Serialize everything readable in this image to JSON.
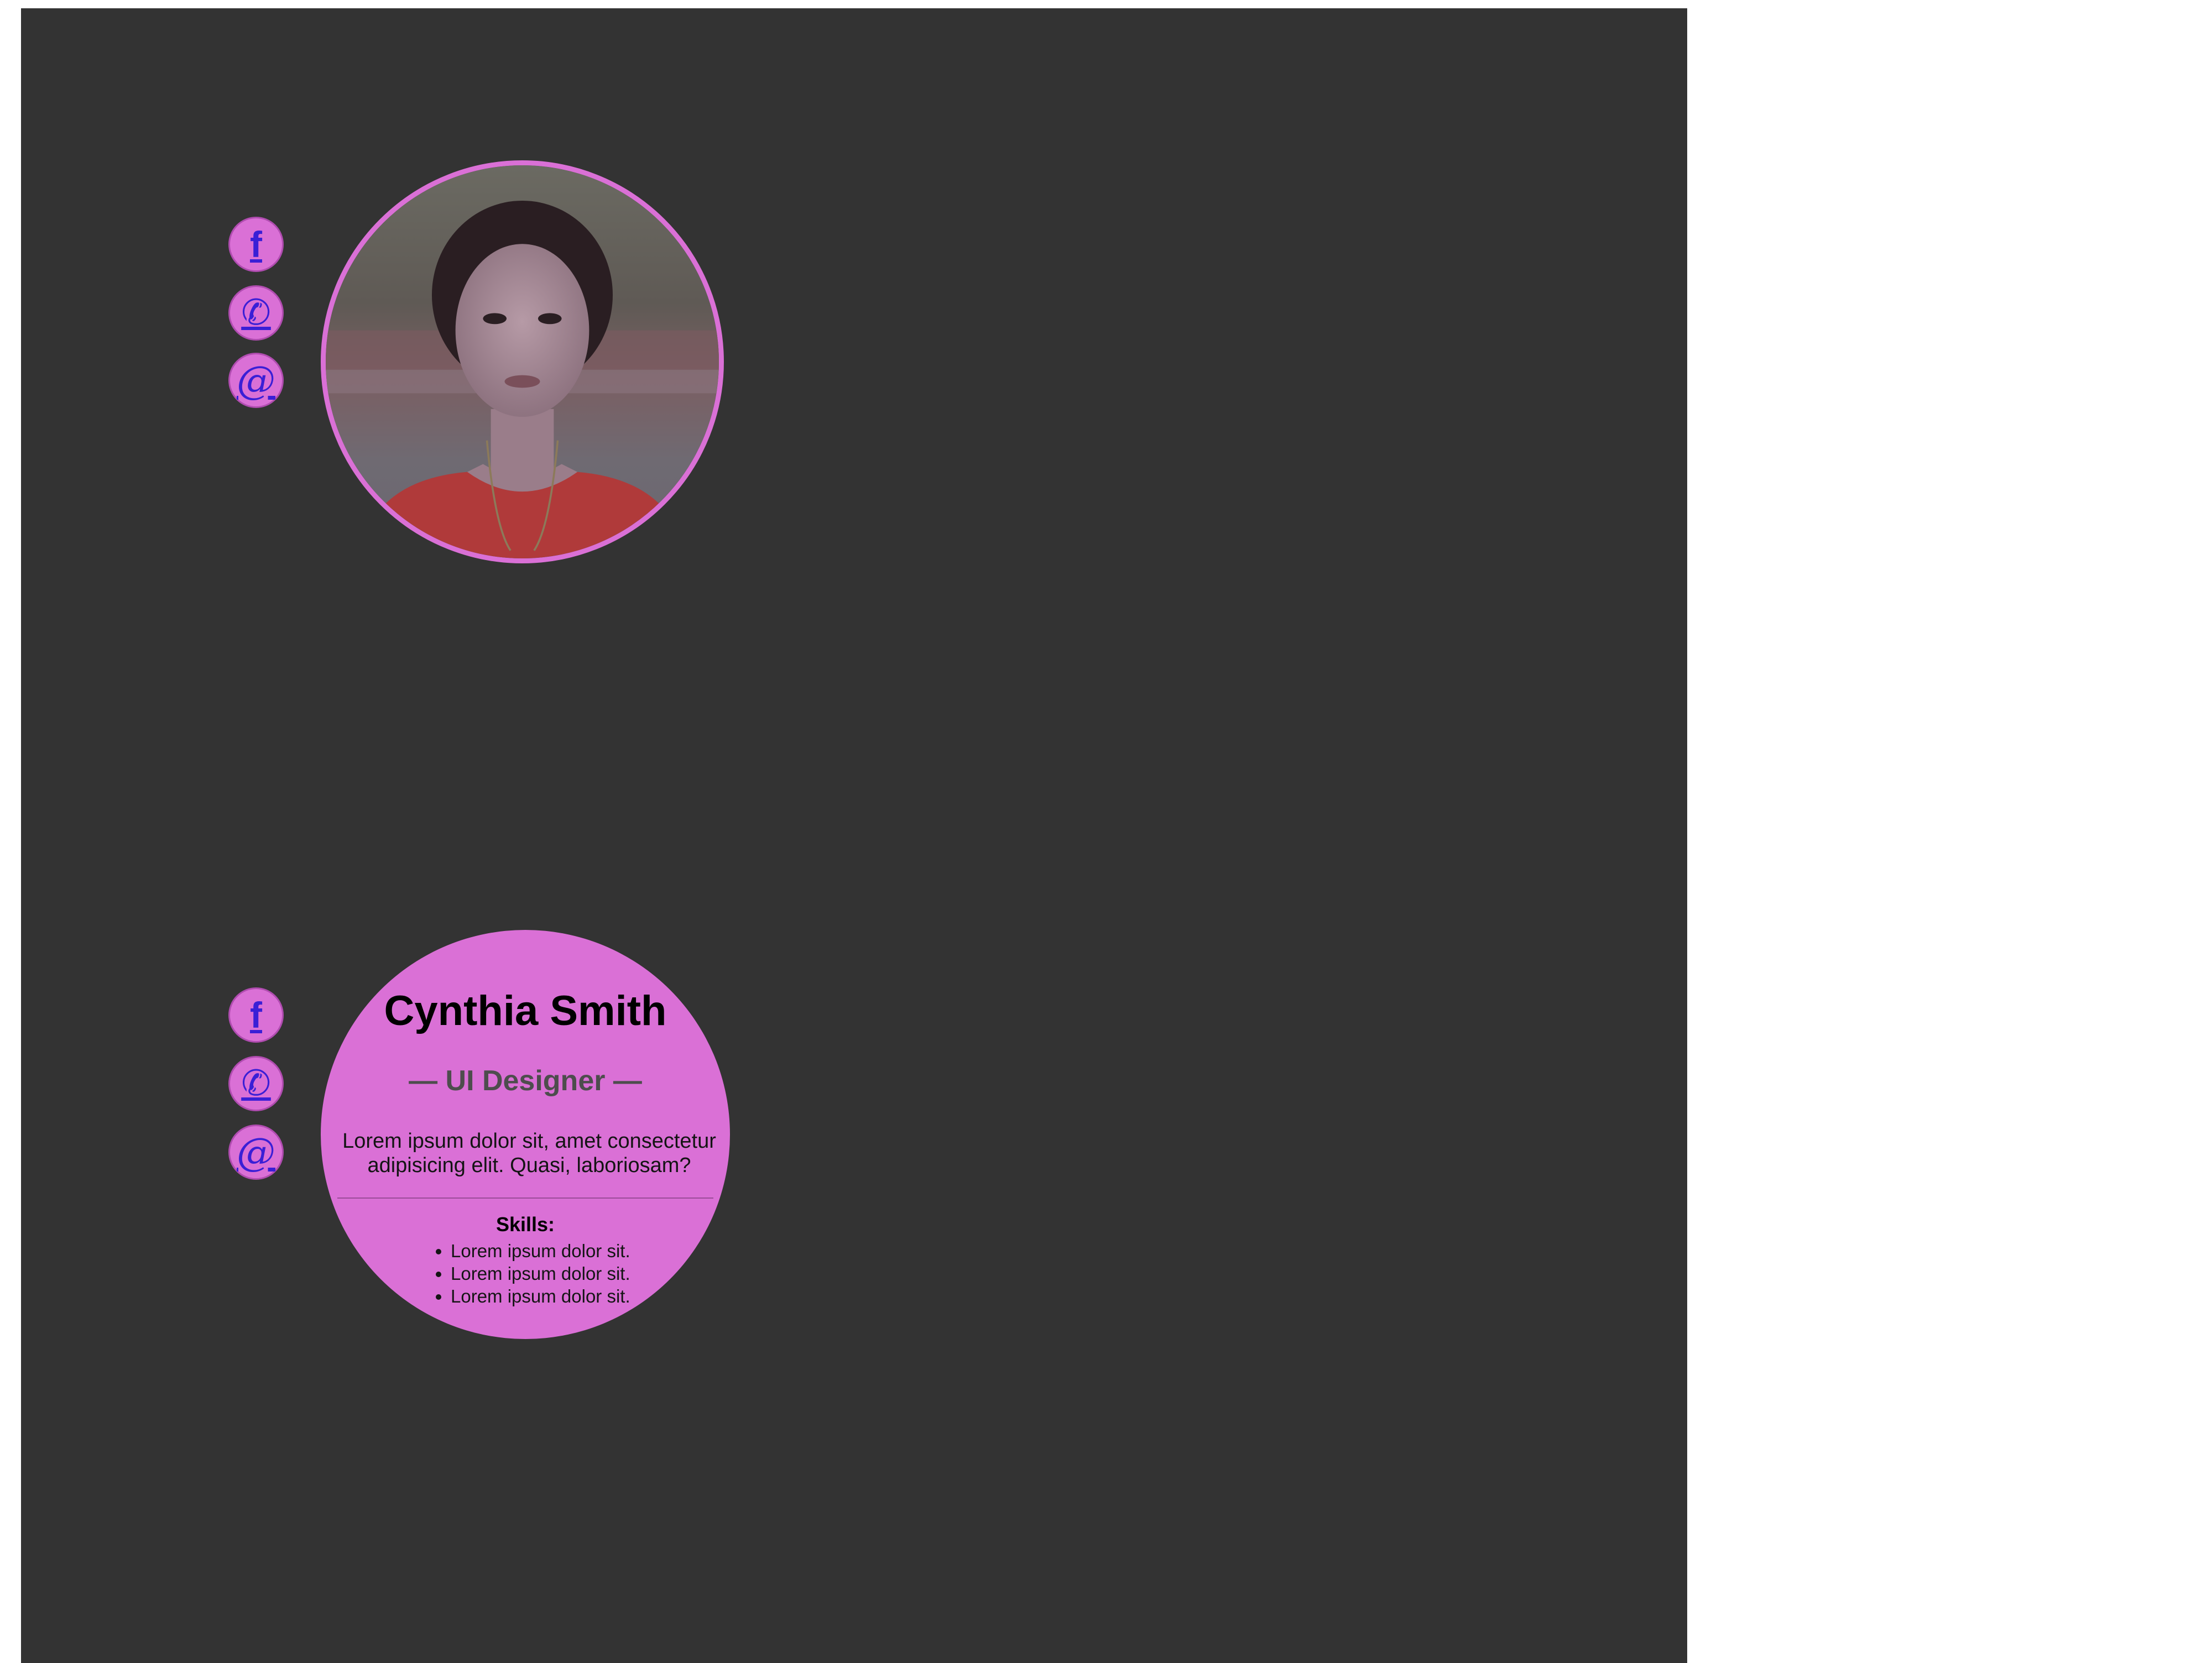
{
  "social": [
    {
      "glyph": "f",
      "icon": "facebook-icon"
    },
    {
      "glyph": "✆",
      "icon": "phone-icon"
    },
    {
      "glyph": "@",
      "icon": "email-icon"
    }
  ],
  "profile": {
    "name": "Cynthia Smith",
    "role": "— UI Designer —",
    "description": "Lorem ipsum dolor sit, amet consectetur adipisicing elit. Quasi, laboriosam?",
    "skills_title": "Skills:",
    "skills": [
      "Lorem ipsum dolor sit.",
      "Lorem ipsum dolor sit.",
      "Lorem ipsum dolor sit."
    ]
  },
  "colors": {
    "accent": "#da70d6",
    "background": "#333333",
    "link": "#3a1fd6"
  }
}
